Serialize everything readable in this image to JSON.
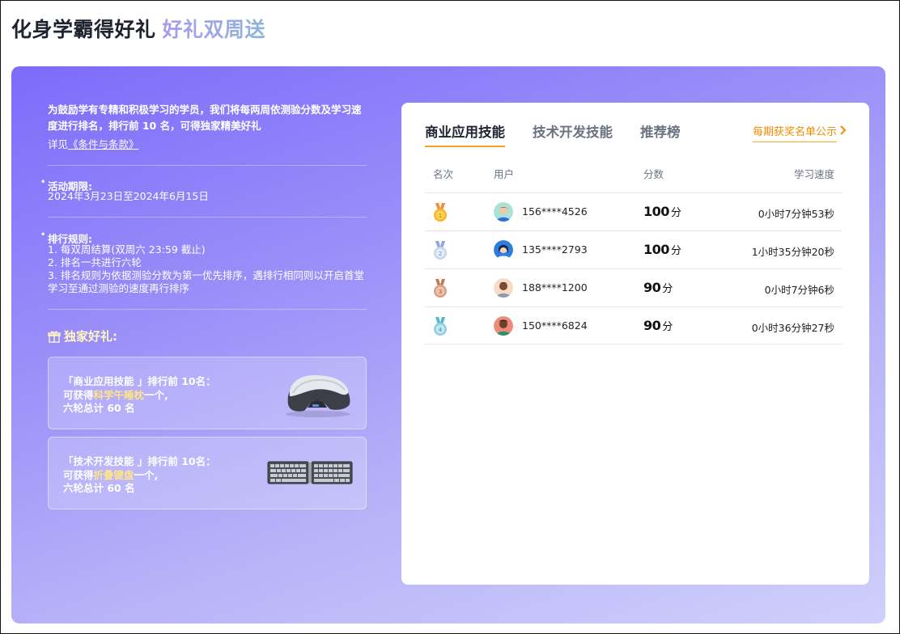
{
  "page": {
    "title_main": "化身学霸得好礼",
    "title_sub": "好礼双周送"
  },
  "intro": {
    "text": "为鼓励学有专精和积极学习的学员，我们将每两周依测验分数及学习速度进行排名，排行前 10 名，可得独家精美好礼",
    "link_prefix": "详见",
    "link_text": "《条件与条款》"
  },
  "period": {
    "label": "活动期限:",
    "value": "2024年3月23日至2024年6月15日"
  },
  "rules": {
    "label": "排行规则:",
    "items": [
      "1. 每双周结算(双周六 23:59 截止)",
      "2. 排名一共进行六轮",
      "3. 排名规则为依据测验分数为第一优先排序，遇排行相同则以开启首堂学习至通过测验的速度再行排序"
    ]
  },
  "gifts": {
    "title": "独家好礼:",
    "cards": [
      {
        "title": "「商业应用技能 」排行前 10名：",
        "prefix": "可获得",
        "item": "科学午睡枕",
        "suffix": "一个,",
        "total": "六轮总计 60 名"
      },
      {
        "title": "「技术开发技能 」排行前 10名：",
        "prefix": "可获得",
        "item": "折叠键盘",
        "suffix": "一个,",
        "total": "六轮总计 60 名"
      }
    ]
  },
  "leaderboard": {
    "tabs": [
      {
        "label": "商业应用技能",
        "active": true
      },
      {
        "label": "技术开发技能",
        "active": false
      },
      {
        "label": "推荐榜",
        "active": false
      }
    ],
    "winners_link": "每期获奖名单公示",
    "columns": {
      "rank": "名次",
      "user": "用户",
      "score": "分数",
      "speed": "学习速度"
    },
    "rows": [
      {
        "medal": "gold-medal-icon",
        "user": "156****4526",
        "score": "100",
        "unit": "分",
        "speed": "0小时7分钟53秒"
      },
      {
        "medal": "silver-medal-icon",
        "user": "135****2793",
        "score": "100",
        "unit": "分",
        "speed": "1小时35分钟20秒"
      },
      {
        "medal": "bronze-medal-icon",
        "user": "188****1200",
        "score": "90",
        "unit": "分",
        "speed": "0小时7分钟6秒"
      },
      {
        "medal": "blue-medal-icon",
        "user": "150****6824",
        "score": "90",
        "unit": "分",
        "speed": "0小时36分钟27秒"
      }
    ]
  },
  "colors": {
    "accent": "#f5a524",
    "hero_start": "#7d6bfa",
    "hero_end": "#cfd0fb",
    "highlight": "#ffe38a"
  }
}
